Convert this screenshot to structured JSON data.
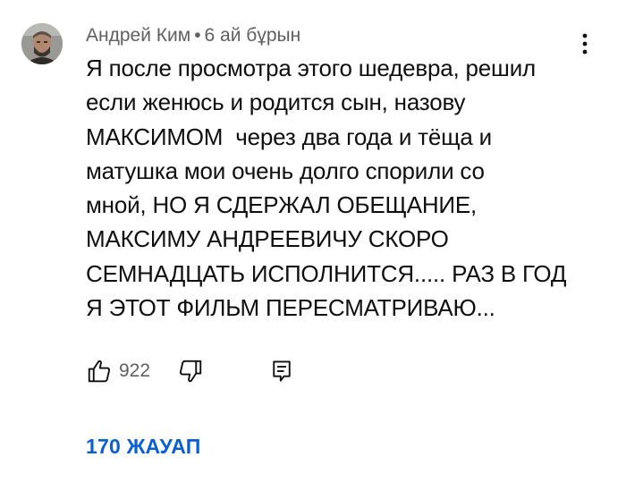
{
  "comment": {
    "author": "Андрей Ким",
    "separator": "•",
    "time": "6 ай бұрын",
    "text_lines": [
      "Я после просмотра этого шедевра, решил",
      "если женюсь и родится сын, назову",
      "МАКСИМОМ  через два года и тёща и",
      "матушка мои очень долго спорили со",
      "мной, НО Я СДЕРЖАЛ ОБЕЩАНИЕ,",
      "МАКСИМУ АНДРЕЕВИЧУ СКОРО",
      "СЕМНАДЦАТЬ ИСПОЛНИТСЯ..... РАЗ В ГОД",
      "Я ЭТОТ ФИЛЬМ ПЕРЕСМАТРИВАЮ..."
    ],
    "like_count": "922",
    "replies_label": "170 ЖАУАП"
  },
  "icons": {
    "avatar": "user-avatar",
    "more": "more-vert-icon",
    "like": "thumb-up-icon",
    "dislike": "thumb-down-icon",
    "reply": "comment-icon"
  },
  "colors": {
    "meta_text": "#606060",
    "body_text": "#0f0f0f",
    "link_blue": "#065fd4"
  }
}
